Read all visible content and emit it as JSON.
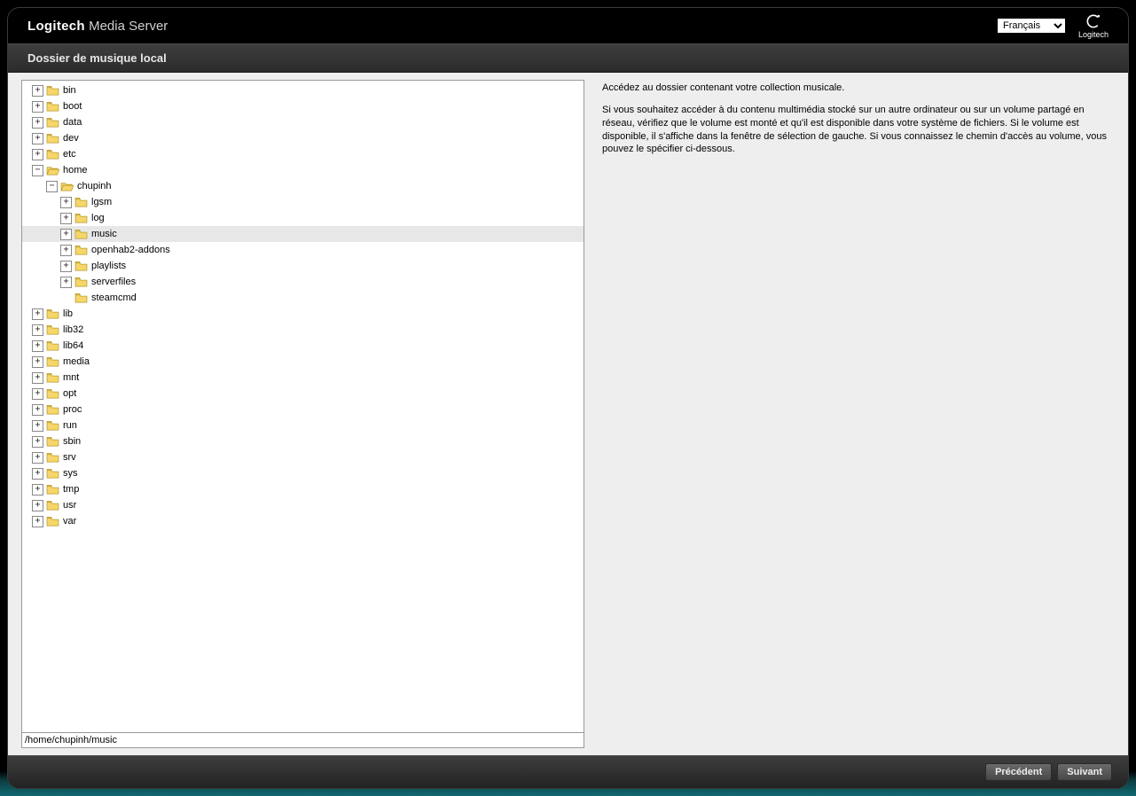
{
  "header": {
    "brand_bold": "Logitech",
    "brand_rest": " Media Server",
    "language": "Français",
    "logo_text": "Logitech"
  },
  "subheader": {
    "title": "Dossier de musique local"
  },
  "instructions": {
    "p1": "Accédez au dossier contenant votre collection musicale.",
    "p2": "Si vous souhaitez accéder à du contenu multimédia stocké sur un autre ordinateur ou sur un volume partagé en réseau, vérifiez que le volume est monté et qu'il est disponible dans votre système de fichiers. Si le volume est disponible, il s'affiche dans la fenêtre de sélection de gauche. Si vous connaissez le chemin d'accès au volume, vous pouvez le spécifier ci-dessous."
  },
  "path_value": "/home/chupinh/music",
  "footer": {
    "prev": "Précédent",
    "next": "Suivant"
  },
  "tree": [
    {
      "label": "bin",
      "depth": 0,
      "toggle": "plus",
      "open": false
    },
    {
      "label": "boot",
      "depth": 0,
      "toggle": "plus",
      "open": false
    },
    {
      "label": "data",
      "depth": 0,
      "toggle": "plus",
      "open": false
    },
    {
      "label": "dev",
      "depth": 0,
      "toggle": "plus",
      "open": false
    },
    {
      "label": "etc",
      "depth": 0,
      "toggle": "plus",
      "open": false
    },
    {
      "label": "home",
      "depth": 0,
      "toggle": "minus",
      "open": true
    },
    {
      "label": "chupinh",
      "depth": 1,
      "toggle": "minus",
      "open": true
    },
    {
      "label": "lgsm",
      "depth": 2,
      "toggle": "plus",
      "open": false
    },
    {
      "label": "log",
      "depth": 2,
      "toggle": "plus",
      "open": false
    },
    {
      "label": "music",
      "depth": 2,
      "toggle": "plus",
      "open": false,
      "selected": true
    },
    {
      "label": "openhab2-addons",
      "depth": 2,
      "toggle": "plus",
      "open": false
    },
    {
      "label": "playlists",
      "depth": 2,
      "toggle": "plus",
      "open": false
    },
    {
      "label": "serverfiles",
      "depth": 2,
      "toggle": "plus",
      "open": false
    },
    {
      "label": "steamcmd",
      "depth": 2,
      "toggle": "none",
      "open": false
    },
    {
      "label": "lib",
      "depth": 0,
      "toggle": "plus",
      "open": false
    },
    {
      "label": "lib32",
      "depth": 0,
      "toggle": "plus",
      "open": false
    },
    {
      "label": "lib64",
      "depth": 0,
      "toggle": "plus",
      "open": false
    },
    {
      "label": "media",
      "depth": 0,
      "toggle": "plus",
      "open": false
    },
    {
      "label": "mnt",
      "depth": 0,
      "toggle": "plus",
      "open": false
    },
    {
      "label": "opt",
      "depth": 0,
      "toggle": "plus",
      "open": false
    },
    {
      "label": "proc",
      "depth": 0,
      "toggle": "plus",
      "open": false
    },
    {
      "label": "run",
      "depth": 0,
      "toggle": "plus",
      "open": false
    },
    {
      "label": "sbin",
      "depth": 0,
      "toggle": "plus",
      "open": false
    },
    {
      "label": "srv",
      "depth": 0,
      "toggle": "plus",
      "open": false
    },
    {
      "label": "sys",
      "depth": 0,
      "toggle": "plus",
      "open": false
    },
    {
      "label": "tmp",
      "depth": 0,
      "toggle": "plus",
      "open": false
    },
    {
      "label": "usr",
      "depth": 0,
      "toggle": "plus",
      "open": false
    },
    {
      "label": "var",
      "depth": 0,
      "toggle": "plus",
      "open": false
    }
  ]
}
